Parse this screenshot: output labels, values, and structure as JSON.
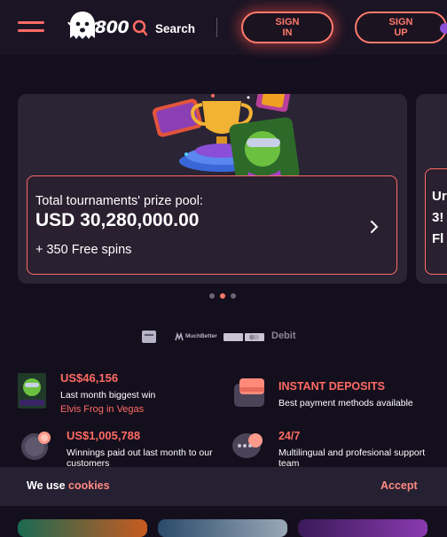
{
  "header": {
    "logo_text": "800",
    "search_label": "Search",
    "signin_label": "SIGN\nIN",
    "signup_label": "SIGN\nUP"
  },
  "carousel": {
    "slides": [
      {
        "subtitle": "Total tournaments' prize pool:",
        "amount": "USD 30,280,000.00",
        "extra": "+ 350 Free spins"
      },
      {
        "peek_text": "Ur\n3!\nFl"
      }
    ],
    "dots_count": 3,
    "active_dot": 2
  },
  "payments": [
    "paysafecard",
    "MuchBetter",
    "VISA",
    "Mastercard",
    "Debit"
  ],
  "payments_labels": {
    "muchbetter": "MuchBetter",
    "debit": "Debit"
  },
  "stats": [
    {
      "amount": "US$46,156",
      "desc": "Last month biggest win",
      "link": "Elvis Frog in Vegas"
    },
    {
      "amount": "US$1,005,788",
      "desc": "Winnings paid out last month to our customers"
    }
  ],
  "features": [
    {
      "title": "INSTANT DEPOSITS",
      "desc": "Best payment methods available"
    },
    {
      "title": "24/7",
      "desc": "Multilingual and profesional support team"
    }
  ],
  "cookie": {
    "text": "We use",
    "link": "cookies",
    "accept": "Accept"
  },
  "colors": {
    "accent": "#ff6b63",
    "background": "#140f1d",
    "card": "#2a2434"
  }
}
